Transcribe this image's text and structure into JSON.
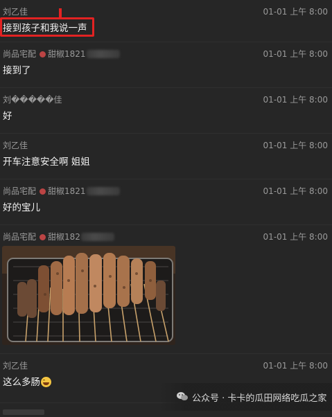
{
  "messages": [
    {
      "sender": "刘乙佳",
      "time": "01-01 上午 8:00",
      "text": "接到孩子和我说一声"
    },
    {
      "sender": "尚品宅配",
      "nick": "甜椒1821",
      "time": "01-01 上午 8:00",
      "text": "接到了"
    },
    {
      "sender": "刘�����佳",
      "time": "01-01 上午 8:00",
      "text": "好"
    },
    {
      "sender": "刘乙佳",
      "time": "01-01 上午 8:00",
      "text": "开车注意安全啊 姐姐"
    },
    {
      "sender": "尚品宅配",
      "nick": "甜椒1821",
      "time": "01-01 上午 8:00",
      "text": "好的宝儿"
    },
    {
      "sender": "尚品宅配",
      "nick": "甜椒182",
      "time": "01-01 上午 8:00",
      "text": ""
    },
    {
      "sender": "刘乙佳",
      "time": "01-01 上午 8:00",
      "text": "这么多肠"
    }
  ],
  "image_message": {
    "icon": "photo-grilled-skewers"
  },
  "emoji": {
    "icon": "grinning-sweat-emoji"
  },
  "watermark": {
    "text": "公众号 · 卡卡的瓜田网络吃瓜之家",
    "icon": "wechat-icon"
  },
  "colors": {
    "highlight": "#e22222",
    "background": "#262626"
  }
}
